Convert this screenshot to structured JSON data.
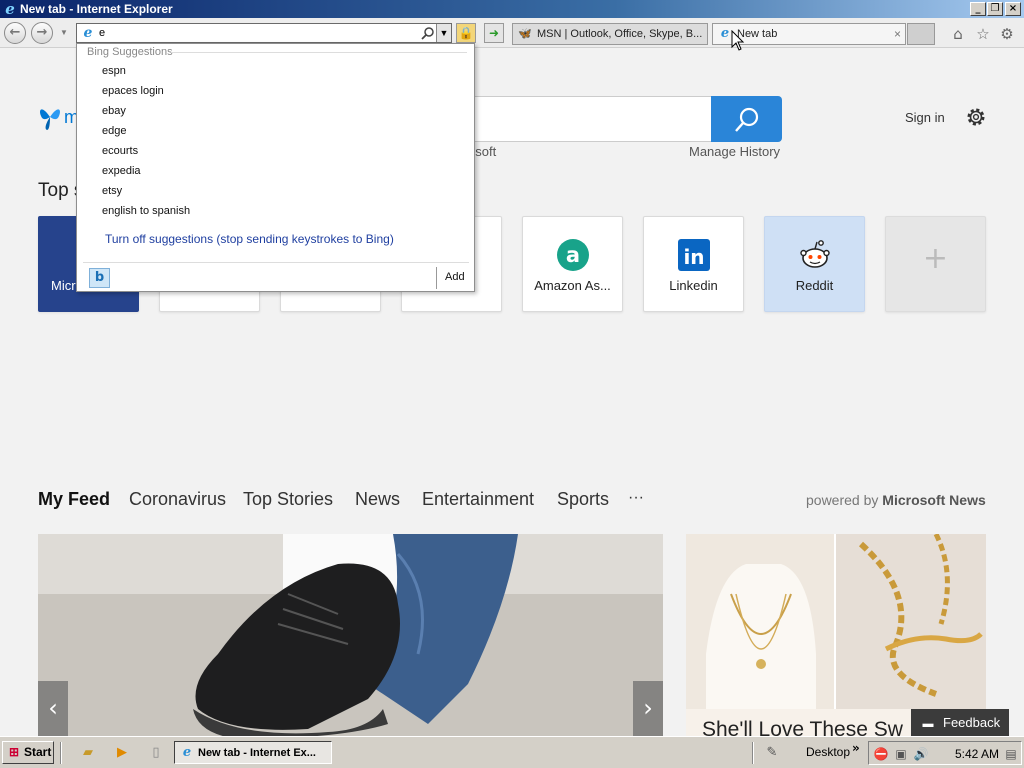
{
  "window": {
    "title": "New tab - Internet Explorer"
  },
  "address_bar": {
    "value": "e"
  },
  "tabs": [
    {
      "label": "MSN | Outlook, Office, Skype, B..."
    },
    {
      "label": "New tab"
    }
  ],
  "suggestions": {
    "header": "Bing Suggestions",
    "items": [
      "espn",
      "epaces login",
      "ebay",
      "edge",
      "ecourts",
      "expedia",
      "etsy",
      "english to spanish"
    ],
    "turn_off": "Turn off suggestions (stop sending keystrokes to Bing)",
    "add_label": "Add"
  },
  "header": {
    "logo_text": "m",
    "by_text": "osoft",
    "manage_history": "Manage History",
    "sign_in": "Sign in"
  },
  "top_sites": {
    "heading": "Top s",
    "tiles": [
      {
        "label": "Micr"
      },
      {
        "label": "Amazon As..."
      },
      {
        "label": "Linkedin"
      },
      {
        "label": "Reddit"
      }
    ],
    "add_symbol": "+"
  },
  "feed": {
    "tabs": [
      "My Feed",
      "Coronavirus",
      "Top Stories",
      "News",
      "Entertainment",
      "Sports",
      "···"
    ],
    "powered_prefix": "powered by",
    "powered_brand": "Microsoft News",
    "card2_caption": "She'll Love These Sw",
    "feedback": "Feedback"
  },
  "taskbar": {
    "start": "Start",
    "active_task": "New tab - Internet Ex...",
    "desktop": "Desktop",
    "chevron": "»",
    "clock": "5:42 AM"
  },
  "colors": {
    "msn_blue": "#0078d4",
    "search_button": "#2a85d8",
    "microsoft_tile": "#26438c",
    "reddit_tile": "#cfe0f5",
    "linkedin": "#0a66c2",
    "amazon_assistant": "#18a38a"
  }
}
